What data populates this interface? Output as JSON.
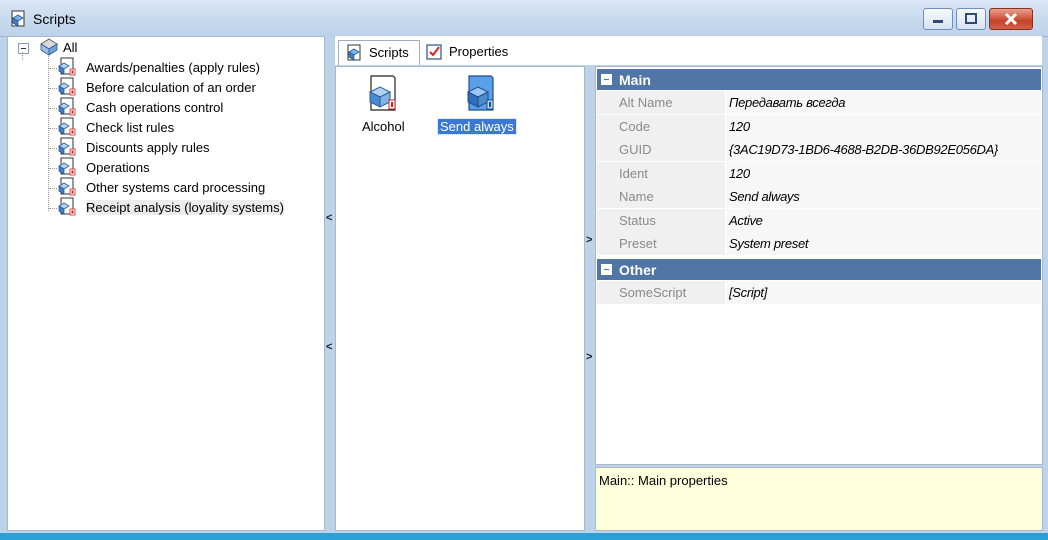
{
  "window": {
    "title": "Scripts",
    "icon": "script-icon",
    "controls": [
      "minimize-icon",
      "maximize-icon",
      "close-icon"
    ]
  },
  "tree": {
    "root": {
      "label": "All",
      "icon": "all-folder-icon"
    },
    "items": [
      {
        "label": "Awards/penalties (apply rules)"
      },
      {
        "label": "Before calculation of an order"
      },
      {
        "label": "Cash operations control"
      },
      {
        "label": "Check list rules"
      },
      {
        "label": "Discounts apply rules"
      },
      {
        "label": "Operations"
      },
      {
        "label": "Other systems card processing"
      },
      {
        "label": "Receipt analysis (loyality systems)"
      }
    ],
    "selected_index": 7
  },
  "tabs": [
    {
      "label": "Scripts",
      "icon": "script-icon",
      "active": true
    },
    {
      "label": "Properties",
      "icon": "properties-icon",
      "active": false
    }
  ],
  "scripts": [
    {
      "label": "Alcohol",
      "icon": "script-icon"
    },
    {
      "label": "Send always",
      "icon": "script-icon",
      "selected": true
    }
  ],
  "properties": {
    "categories": [
      {
        "name": "Main",
        "rows": [
          {
            "name": "Alt Name",
            "value": "Передавать всегда"
          },
          {
            "name": "Code",
            "value": "120"
          },
          {
            "name": "GUID",
            "value": "{3AC19D73-1BD6-4688-B2DB-36DB92E056DA}"
          },
          {
            "name": "Ident",
            "value": "120"
          },
          {
            "name": "Name",
            "value": "Send always"
          },
          {
            "name": "Status",
            "value": "Active"
          },
          {
            "name": "Preset",
            "value": "System preset"
          }
        ]
      },
      {
        "name": "Other",
        "rows": [
          {
            "name": "SomeScript",
            "value": "[Script]"
          }
        ]
      }
    ]
  },
  "description": "Main:: Main properties",
  "splitter_arrows": {
    "left": "<",
    "right": ">"
  },
  "colors": {
    "category_header": "#4f76a4",
    "selection": "#3a78d4",
    "description_bg": "#ffffdd",
    "window_bg": "#bcd3ea"
  }
}
